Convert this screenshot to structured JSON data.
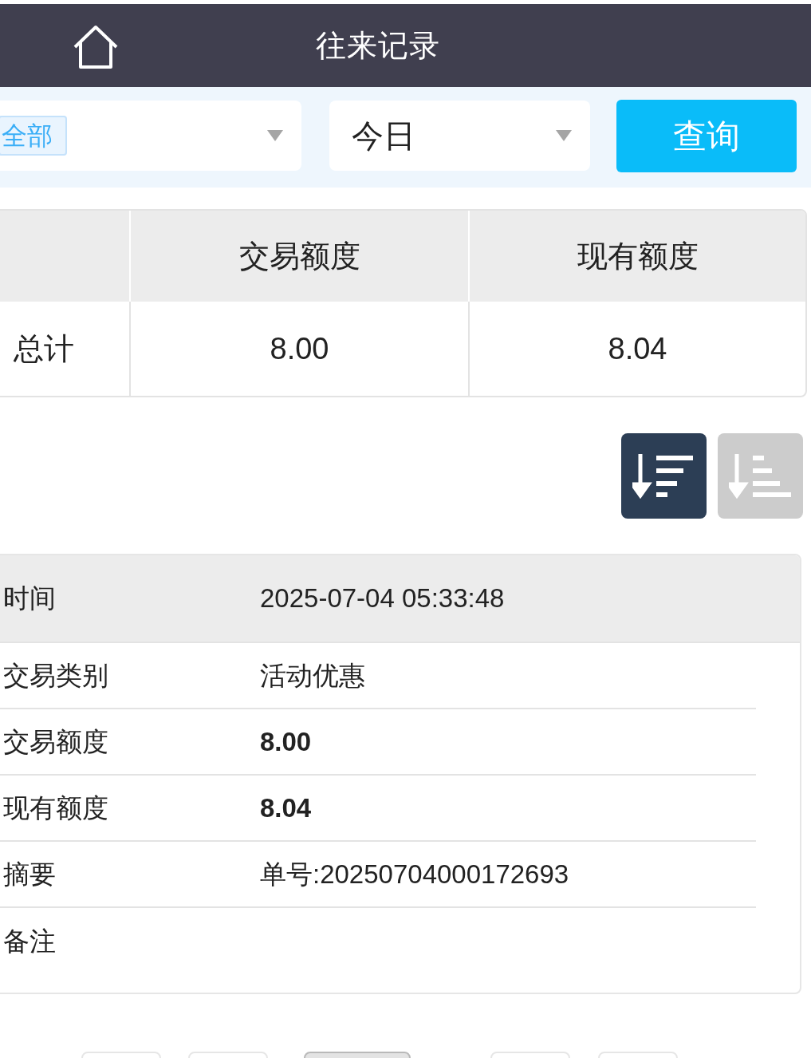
{
  "header": {
    "title": "往来记录"
  },
  "filters": {
    "category_chip": "全部",
    "period": "今日",
    "query_button": "查询"
  },
  "summary": {
    "columns": [
      "交易额度",
      "现有额度"
    ],
    "rows": [
      {
        "label": "总计",
        "cells": [
          "8.00",
          "8.04"
        ]
      }
    ]
  },
  "sort_buttons": [
    {
      "kind": "descending",
      "selected": true
    },
    {
      "kind": "ascending",
      "selected": false
    }
  ],
  "record": {
    "rows": [
      {
        "label": "时间",
        "value": "2025-07-04 05:33:48",
        "kind": "header"
      },
      {
        "label": "交易类别",
        "value": "活动优惠",
        "kind": "plain"
      },
      {
        "label": "交易额度",
        "value": "8.00",
        "kind": "bold"
      },
      {
        "label": "现有额度",
        "value": "8.04",
        "kind": "bold"
      },
      {
        "label": "摘要",
        "value": "单号:20250704000172693",
        "kind": "plain"
      },
      {
        "label": "备注",
        "kind": "plain"
      }
    ]
  },
  "pagination": [
    {
      "selected": false
    },
    {
      "selected": false
    },
    {
      "selected": true
    },
    {
      "selected": false
    },
    {
      "selected": false
    }
  ]
}
